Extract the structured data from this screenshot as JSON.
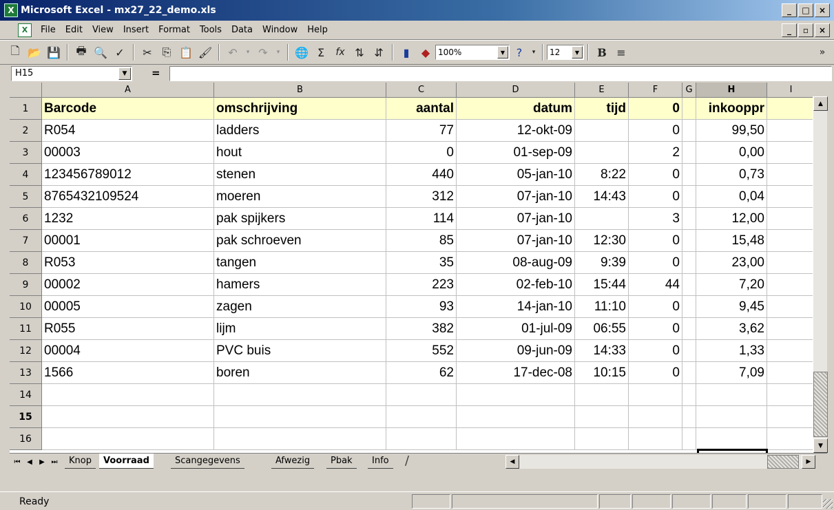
{
  "window": {
    "title": "Microsoft Excel - mx27_22_demo.xls",
    "minimize": "_",
    "restore": "□",
    "close": "×"
  },
  "menu": {
    "items": [
      {
        "id": "file",
        "label": "File"
      },
      {
        "id": "edit",
        "label": "Edit"
      },
      {
        "id": "view",
        "label": "View"
      },
      {
        "id": "insert",
        "label": "Insert"
      },
      {
        "id": "format",
        "label": "Format"
      },
      {
        "id": "tools",
        "label": "Tools"
      },
      {
        "id": "data",
        "label": "Data"
      },
      {
        "id": "window",
        "label": "Window"
      },
      {
        "id": "help",
        "label": "Help"
      }
    ],
    "doc_min": "_",
    "doc_restore": "▫",
    "doc_close": "×"
  },
  "toolbar": {
    "zoom": "100%",
    "font_size": "12",
    "bold": "B",
    "sigma": "Σ",
    "fx": "fx",
    "overflow": "»"
  },
  "formula_bar": {
    "name_box": "H15",
    "equals": "="
  },
  "grid": {
    "columns": [
      "A",
      "B",
      "C",
      "D",
      "E",
      "F",
      "G",
      "H",
      "I"
    ],
    "active_column": "H",
    "row_numbers": [
      "1",
      "2",
      "3",
      "4",
      "5",
      "6",
      "7",
      "8",
      "9",
      "10",
      "11",
      "12",
      "13",
      "14",
      "15",
      "16"
    ],
    "active_row": "15",
    "header_row": [
      "Barcode",
      "omschrijving",
      "aantal",
      "datum",
      "tijd",
      "0",
      "",
      "inkooppr",
      ""
    ],
    "rows": [
      [
        "R054",
        "ladders",
        "77",
        "12-okt-09",
        "",
        "0",
        "",
        "99,50",
        ""
      ],
      [
        "00003",
        "hout",
        "0",
        "01-sep-09",
        "",
        "2",
        "",
        "0,00",
        ""
      ],
      [
        "123456789012",
        "stenen",
        "440",
        "05-jan-10",
        "8:22",
        "0",
        "",
        "0,73",
        ""
      ],
      [
        "8765432109524",
        "moeren",
        "312",
        "07-jan-10",
        "14:43",
        "0",
        "",
        "0,04",
        ""
      ],
      [
        "1232",
        "pak spijkers",
        "114",
        "07-jan-10",
        "",
        "3",
        "",
        "12,00",
        ""
      ],
      [
        "00001",
        "pak schroeven",
        "85",
        "07-jan-10",
        "12:30",
        "0",
        "",
        "15,48",
        ""
      ],
      [
        "R053",
        "tangen",
        "35",
        "08-aug-09",
        "9:39",
        "0",
        "",
        "23,00",
        ""
      ],
      [
        "00002",
        "hamers",
        "223",
        "02-feb-10",
        "15:44",
        "44",
        "",
        "7,20",
        ""
      ],
      [
        "00005",
        "zagen",
        "93",
        "14-jan-10",
        "11:10",
        "0",
        "",
        "9,45",
        ""
      ],
      [
        "R055",
        "lijm",
        "382",
        "01-jul-09",
        "06:55",
        "0",
        "",
        "3,62",
        ""
      ],
      [
        "00004",
        "PVC buis",
        "552",
        "09-jun-09",
        "14:33",
        "0",
        "",
        "1,33",
        ""
      ],
      [
        "1566",
        "boren",
        "62",
        "17-dec-08",
        "10:15",
        "0",
        "",
        "7,09",
        ""
      ],
      [
        "",
        "",
        "",
        "",
        "",
        "",
        "",
        "",
        ""
      ],
      [
        "",
        "",
        "",
        "",
        "",
        "",
        "",
        "",
        ""
      ]
    ]
  },
  "sheets": {
    "tabs": [
      {
        "id": "knop",
        "label": "Knop",
        "active": false
      },
      {
        "id": "voorraad",
        "label": "Voorraad",
        "active": true
      },
      {
        "id": "scangegevens",
        "label": "Scangegevens",
        "active": false
      },
      {
        "id": "afwezig",
        "label": "Afwezig",
        "active": false
      },
      {
        "id": "pbak",
        "label": "Pbak",
        "active": false
      },
      {
        "id": "info",
        "label": "Info",
        "active": false
      }
    ]
  },
  "status": {
    "text": "Ready"
  }
}
